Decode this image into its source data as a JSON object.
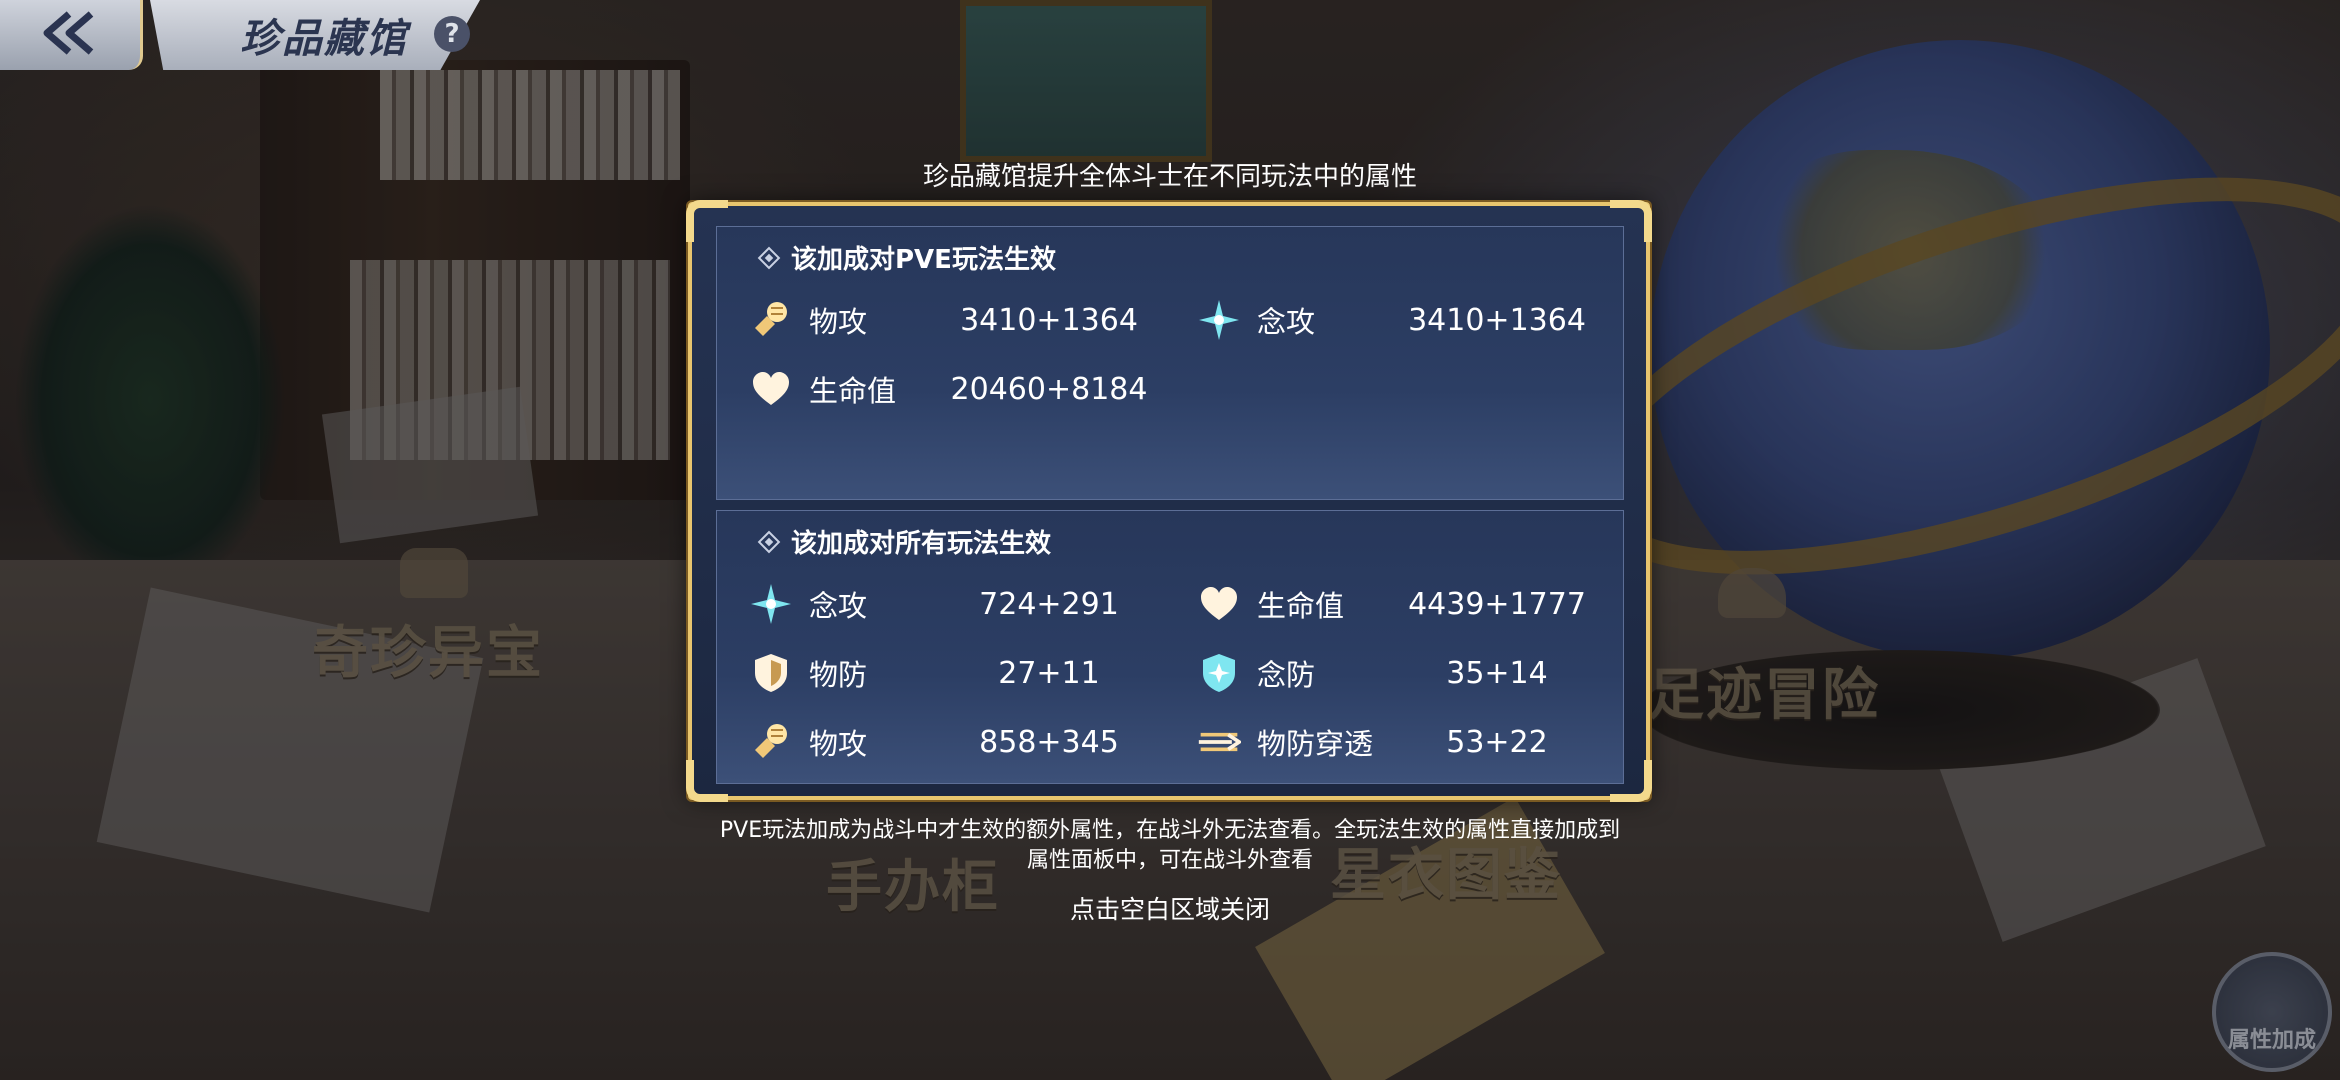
{
  "header": {
    "title": "珍品藏馆",
    "help_glyph": "?"
  },
  "scene": {
    "labels": [
      "奇珍异宝",
      "足迹冒险",
      "手办柜",
      "星衣图鉴"
    ],
    "attr_button_label": "属性加成"
  },
  "popup": {
    "title": "珍品藏馆提升全体斗士在不同玩法中的属性",
    "pve_section": {
      "heading": "该加成对PVE玩法生效",
      "stats": [
        {
          "icon": "fist-icon",
          "name": "物攻",
          "value": "3410+1364"
        },
        {
          "icon": "spirit-star-icon",
          "name": "念攻",
          "value": "3410+1364"
        },
        {
          "icon": "heart-icon",
          "name": "生命值",
          "value": "20460+8184"
        }
      ]
    },
    "all_section": {
      "heading": "该加成对所有玩法生效",
      "stats": [
        {
          "icon": "spirit-star-icon",
          "name": "念攻",
          "value": "724+291"
        },
        {
          "icon": "heart-icon",
          "name": "生命值",
          "value": "4439+1777"
        },
        {
          "icon": "shield-icon",
          "name": "物防",
          "value": "27+11"
        },
        {
          "icon": "spirit-shield-icon",
          "name": "念防",
          "value": "35+14"
        },
        {
          "icon": "fist-icon",
          "name": "物攻",
          "value": "858+345"
        },
        {
          "icon": "penetration-icon",
          "name": "物防穿透",
          "value": "53+22"
        }
      ]
    },
    "footnote_line1": "PVE玩法加成为战斗中才生效的额外属性，在战斗外无法查看。全玩法生效的属性直接加成到",
    "footnote_line2": "属性面板中，可在战斗外查看",
    "close_hint": "点击空白区域关闭"
  },
  "colors": {
    "panel_border": "#e8c56e",
    "panel_bg": "#1c2740",
    "text": "#ffffff",
    "icon_gold": "#f0c878",
    "icon_cyan": "#7fe6f0"
  }
}
